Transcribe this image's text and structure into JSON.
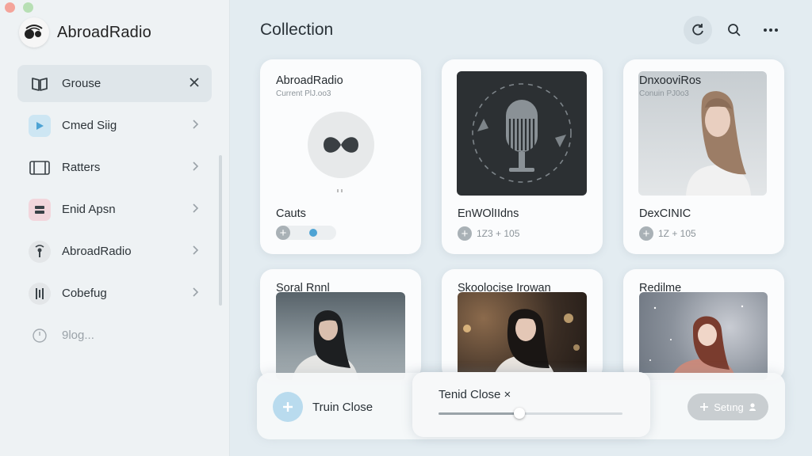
{
  "app": {
    "title": "AbroadRadio"
  },
  "sidebar": {
    "items": [
      {
        "label": "Grouse",
        "icon": "book-icon",
        "trail": "close-icon",
        "active": true
      },
      {
        "label": "Cmed Siig",
        "icon": "play-icon",
        "trail": "chevron-right-icon"
      },
      {
        "label": "Ratters",
        "icon": "film-icon",
        "trail": "chevron-right-icon"
      },
      {
        "label": "Enid Apsn",
        "icon": "list-icon",
        "trail": "chevron-right-icon"
      },
      {
        "label": "AbroadRadio",
        "icon": "radio-icon",
        "trail": "chevron-right-icon"
      },
      {
        "label": "Cobefug",
        "icon": "equalizer-icon",
        "trail": "chevron-right-icon"
      },
      {
        "label": "9log...",
        "icon": "clock-icon",
        "muted": true
      }
    ]
  },
  "main": {
    "title": "Collection",
    "actions": [
      "refresh-icon",
      "search-icon",
      "more-icon"
    ]
  },
  "cards": [
    {
      "title": "AbroadRadio",
      "subtitle": "Current PlJ.oo3",
      "caption": "Cauts",
      "art": "infinity-icon"
    },
    {
      "title": "",
      "caption": "EnWOlIIdns",
      "meta": "1Z3 + 105",
      "art": "microphone-icon"
    },
    {
      "title": "DnxooviRos",
      "subtitle": "Conuin PJ0o3",
      "caption": "DexCINIC",
      "meta": "1Z + 105",
      "art": "portrait-photo"
    },
    {
      "title": "Soral Rnnl",
      "art": "portrait-photo"
    },
    {
      "title": "Skoolocise Irowan",
      "art": "portrait-photo"
    },
    {
      "title": "Redilme",
      "art": "portrait-photo"
    }
  ],
  "dock": {
    "label": "Truin Close"
  },
  "panel": {
    "title": "Tenid Close ×",
    "progress": 0.44
  },
  "setting_button": {
    "label": "Setıng"
  },
  "colors": {
    "accent": "#b9dbee",
    "sidebar_bg": "#eef2f4",
    "page_bg": "#e3ecf1"
  }
}
